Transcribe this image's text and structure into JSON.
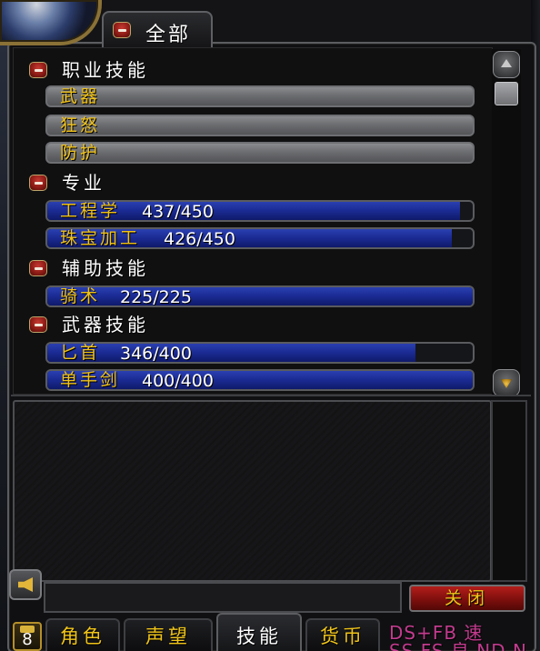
{
  "top_tab": {
    "label": "全部"
  },
  "skills": [
    {
      "type": "header",
      "label": "职业技能"
    },
    {
      "type": "skill",
      "name": "武器",
      "value": "",
      "fill": 0,
      "style": "grey"
    },
    {
      "type": "skill",
      "name": "狂怒",
      "value": "",
      "fill": 0,
      "style": "grey"
    },
    {
      "type": "skill",
      "name": "防护",
      "value": "",
      "fill": 0,
      "style": "grey"
    },
    {
      "type": "header",
      "label": "专业"
    },
    {
      "type": "skill",
      "name": "工程学",
      "value": "437/450",
      "fill": 0.97,
      "style": "blue"
    },
    {
      "type": "skill",
      "name": "珠宝加工",
      "value": "426/450",
      "fill": 0.95,
      "style": "blue"
    },
    {
      "type": "header",
      "label": "辅助技能"
    },
    {
      "type": "skill",
      "name": "骑术",
      "value": "225/225",
      "fill": 1.0,
      "style": "blue"
    },
    {
      "type": "header",
      "label": "武器技能"
    },
    {
      "type": "skill",
      "name": "匕首",
      "value": "346/400",
      "fill": 0.865,
      "style": "blue"
    },
    {
      "type": "skill",
      "name": "单手剑",
      "value": "400/400",
      "fill": 1.0,
      "style": "blue"
    }
  ],
  "close_button": {
    "label": "关闭"
  },
  "bottom_tabs": [
    {
      "label": "角色",
      "active": false
    },
    {
      "label": "声望",
      "active": false
    },
    {
      "label": "技能",
      "active": true
    },
    {
      "label": "货币",
      "active": false
    }
  ],
  "badge_number": "8",
  "background_text": {
    "line1": "DS+FB 速",
    "line2": "SS FS 良 ND N"
  },
  "colors": {
    "skill_text": "#f0c219",
    "header_text": "#ffffff",
    "skill_fill": "#1a2a92",
    "close_button": "#a11917",
    "close_text": "#f0c419"
  }
}
